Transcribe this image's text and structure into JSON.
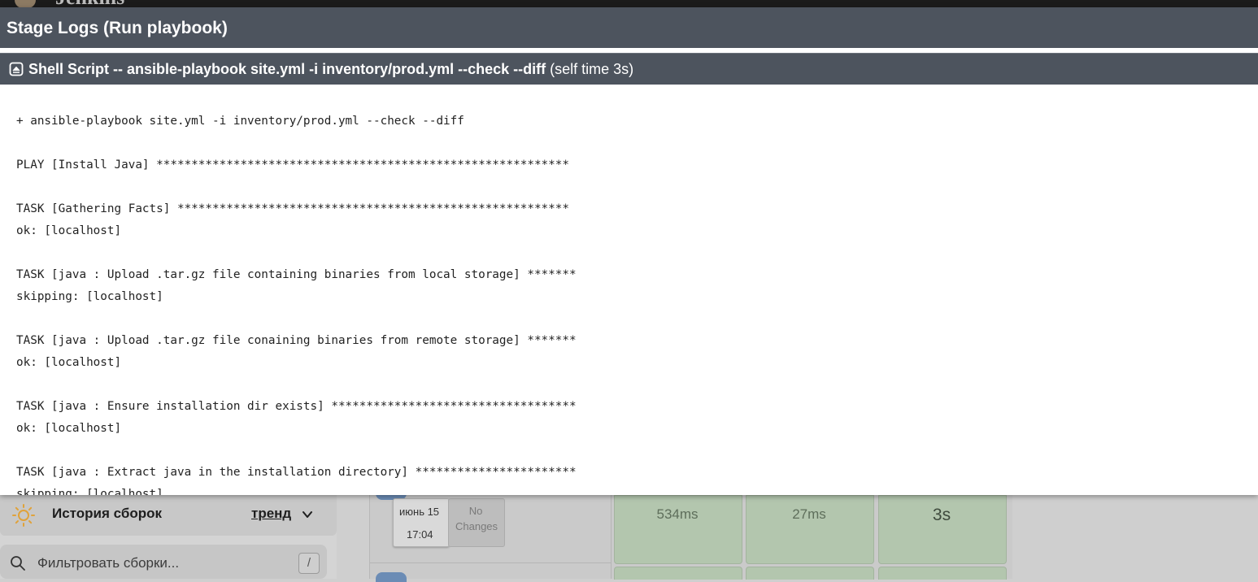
{
  "background": {
    "logo_text": "Jenkins",
    "history": {
      "title": "История сборок",
      "trend_label": "тренд",
      "filter_placeholder": "Фильтровать сборки...",
      "filter_shortcut": "/"
    },
    "build_row": {
      "date": "июнь 15",
      "time": "17:04",
      "changes_label": "No Changes",
      "stage_durations": [
        "534ms",
        "27ms",
        "3s"
      ]
    },
    "colors": {
      "success_cell": "#b3c6ae",
      "build_badge": "#6b8cb5"
    }
  },
  "modal": {
    "title": "Stage Logs (Run playbook)",
    "step": {
      "label": "Shell Script -- ansible-playbook site.yml -i inventory/prod.yml --check --diff",
      "self_time": "(self time 3s)"
    },
    "log_lines": [
      "+ ansible-playbook site.yml -i inventory/prod.yml --check --diff",
      "",
      "PLAY [Install Java] ***********************************************************",
      "",
      "TASK [Gathering Facts] ********************************************************",
      "ok: [localhost]",
      "",
      "TASK [java : Upload .tar.gz file containing binaries from local storage] *******",
      "skipping: [localhost]",
      "",
      "TASK [java : Upload .tar.gz file conaining binaries from remote storage] *******",
      "ok: [localhost]",
      "",
      "TASK [java : Ensure installation dir exists] ***********************************",
      "ok: [localhost]",
      "",
      "TASK [java : Extract java in the installation directory] ***********************",
      "skipping: [localhost]"
    ],
    "colors": {
      "header_bg": "#4d545e",
      "header_text": "#ffffff"
    }
  }
}
